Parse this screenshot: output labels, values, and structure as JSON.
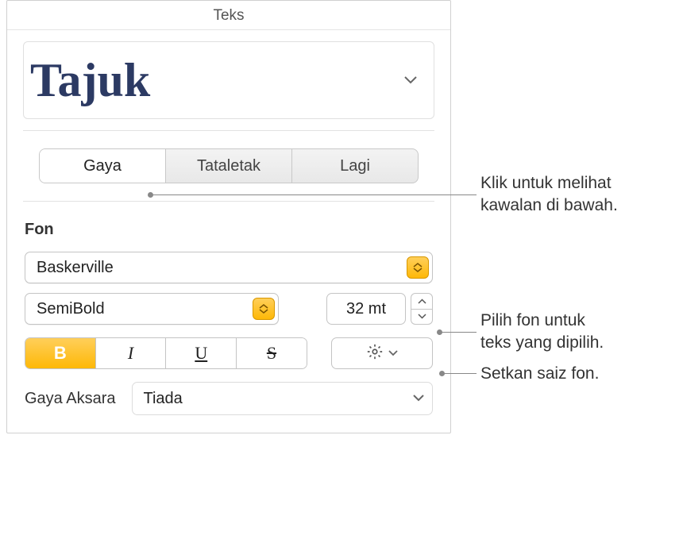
{
  "panel": {
    "title": "Teks",
    "paragraph_style": "Tajuk",
    "tabs": {
      "style": "Gaya",
      "layout": "Tataletak",
      "more": "Lagi"
    },
    "font_section_label": "Fon",
    "font_family": "Baskerville",
    "font_weight": "SemiBold",
    "font_size": "32 mt",
    "format": {
      "bold": "B",
      "italic": "I",
      "underline": "U",
      "strike": "S"
    },
    "char_style_label": "Gaya Aksara",
    "char_style_value": "Tiada"
  },
  "callouts": {
    "tabs_line1": "Klik untuk melihat",
    "tabs_line2": "kawalan di bawah.",
    "font_line1": "Pilih fon untuk",
    "font_line2": "teks yang dipilih.",
    "size_line1": "Setkan saiz fon."
  }
}
